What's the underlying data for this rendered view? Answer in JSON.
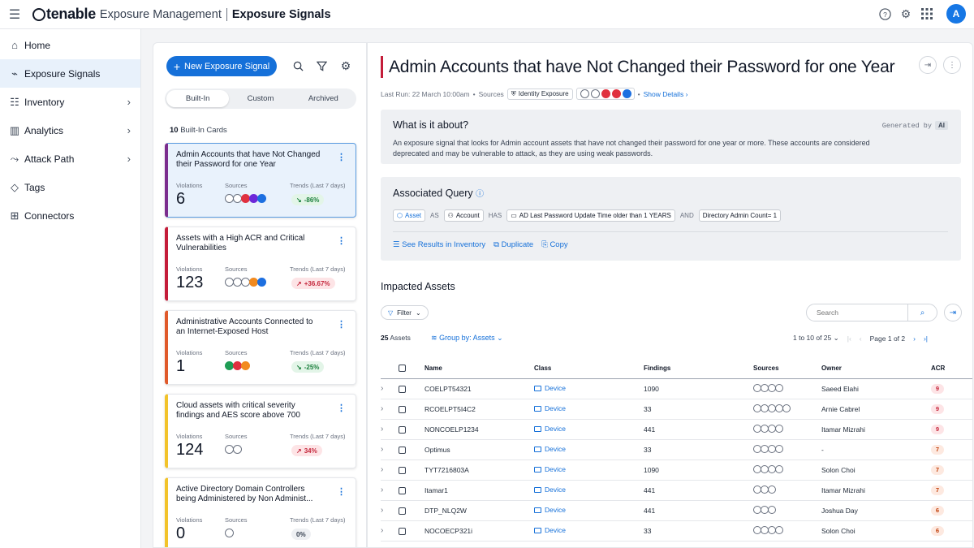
{
  "topbar": {
    "logo": "tenable",
    "product": "Exposure Management",
    "page": "Exposure Signals",
    "avatar_initial": "A"
  },
  "sidebar": {
    "items": [
      {
        "label": "Home",
        "icon": "home-icon"
      },
      {
        "label": "Exposure Signals",
        "icon": "signal-icon",
        "active": true
      },
      {
        "label": "Inventory",
        "icon": "inventory-icon"
      },
      {
        "label": "Analytics",
        "icon": "analytics-icon"
      },
      {
        "label": "Attack Path",
        "icon": "attack-path-icon"
      },
      {
        "label": "Tags",
        "icon": "tag-icon"
      },
      {
        "label": "Connectors",
        "icon": "connectors-icon"
      }
    ]
  },
  "panel": {
    "new_button": "New Exposure Signal",
    "tabs": [
      "Built-In",
      "Custom",
      "Archived"
    ],
    "count_num": "10",
    "count_text": "Built-In Cards",
    "labels": {
      "violations": "Violations",
      "sources": "Sources",
      "trends": "Trends (Last 7 days)"
    },
    "cards": [
      {
        "title": "Admin Accounts that have Not Changed their Password for one Year",
        "violations": "6",
        "trend": "-86%",
        "trend_dir": "down",
        "accent": "#7b2d8e"
      },
      {
        "title": "Assets with a High ACR and Critical Vulnerabilities",
        "violations": "123",
        "trend": "+36.67%",
        "trend_dir": "up",
        "accent": "#c41d3a"
      },
      {
        "title": "Administrative Accounts Connected to an Internet-Exposed Host",
        "violations": "1",
        "trend": "-25%",
        "trend_dir": "down",
        "accent": "#e05a2b"
      },
      {
        "title": "Cloud assets with critical severity findings and AES score above 700",
        "violations": "124",
        "trend": "34%",
        "trend_dir": "up",
        "accent": "#f2c32b"
      },
      {
        "title": "Active Directory Domain Controllers being Administered by Non Administ...",
        "violations": "0",
        "trend": "0%",
        "trend_dir": "flat",
        "accent": "#f2c32b"
      }
    ]
  },
  "detail": {
    "title": "Admin Accounts that have Not Changed their Password for one Year",
    "meta": {
      "last_run": "Last Run: 22 March 10:00am",
      "sources_label": "Sources",
      "source_chip": "Identity Exposure",
      "show_details": "Show Details"
    },
    "about": {
      "heading": "What is it about?",
      "generated_by": "Generated by",
      "ai": "AI",
      "text": "An exposure signal that looks for Admin account assets that have not changed their password for one year or more. These accounts are considered deprecated and may be vulnerable to attack, as they are using weak passwords."
    },
    "query": {
      "heading": "Associated Query",
      "asset": "Asset",
      "as": "AS",
      "account": "Account",
      "has": "HAS",
      "condition": "AD Last Password Update Time older than 1 YEARS",
      "and": "AND",
      "condition2": "Directory Admin Count= 1",
      "see_results": "See Results in Inventory",
      "duplicate": "Duplicate",
      "copy": "Copy"
    },
    "impacted": {
      "heading": "Impacted Assets",
      "filter": "Filter",
      "search_placeholder": "Search",
      "count_num": "25",
      "count_text": "Assets",
      "group_by": "Group by: Assets",
      "range": "1 to 10 of 25",
      "page": "Page 1 of 2",
      "columns": [
        "Name",
        "Class",
        "Findings",
        "Sources",
        "Owner",
        "ACR"
      ],
      "rows": [
        {
          "name": "COELPT54321",
          "class": "Device",
          "findings": "1090",
          "owner": "Saeed Elahi",
          "acr": "9"
        },
        {
          "name": "RCOELPT5I4C2",
          "class": "Device",
          "findings": "33",
          "owner": "Arnie Cabrel",
          "acr": "9"
        },
        {
          "name": "NONCOELP1234",
          "class": "Device",
          "findings": "441",
          "owner": "Itamar Mizrahi",
          "acr": "9"
        },
        {
          "name": "Optimus",
          "class": "Device",
          "findings": "33",
          "owner": "-",
          "acr": "7"
        },
        {
          "name": "TYT7216803A",
          "class": "Device",
          "findings": "1090",
          "owner": "Solon Choi",
          "acr": "7"
        },
        {
          "name": "Itamar1",
          "class": "Device",
          "findings": "441",
          "owner": "Itamar Mizrahi",
          "acr": "7"
        },
        {
          "name": "DTP_NLQ2W",
          "class": "Device",
          "findings": "441",
          "owner": "Joshua Day",
          "acr": "6"
        },
        {
          "name": "NOCOECP321i",
          "class": "Device",
          "findings": "33",
          "owner": "Solon Choi",
          "acr": "6"
        }
      ]
    }
  }
}
